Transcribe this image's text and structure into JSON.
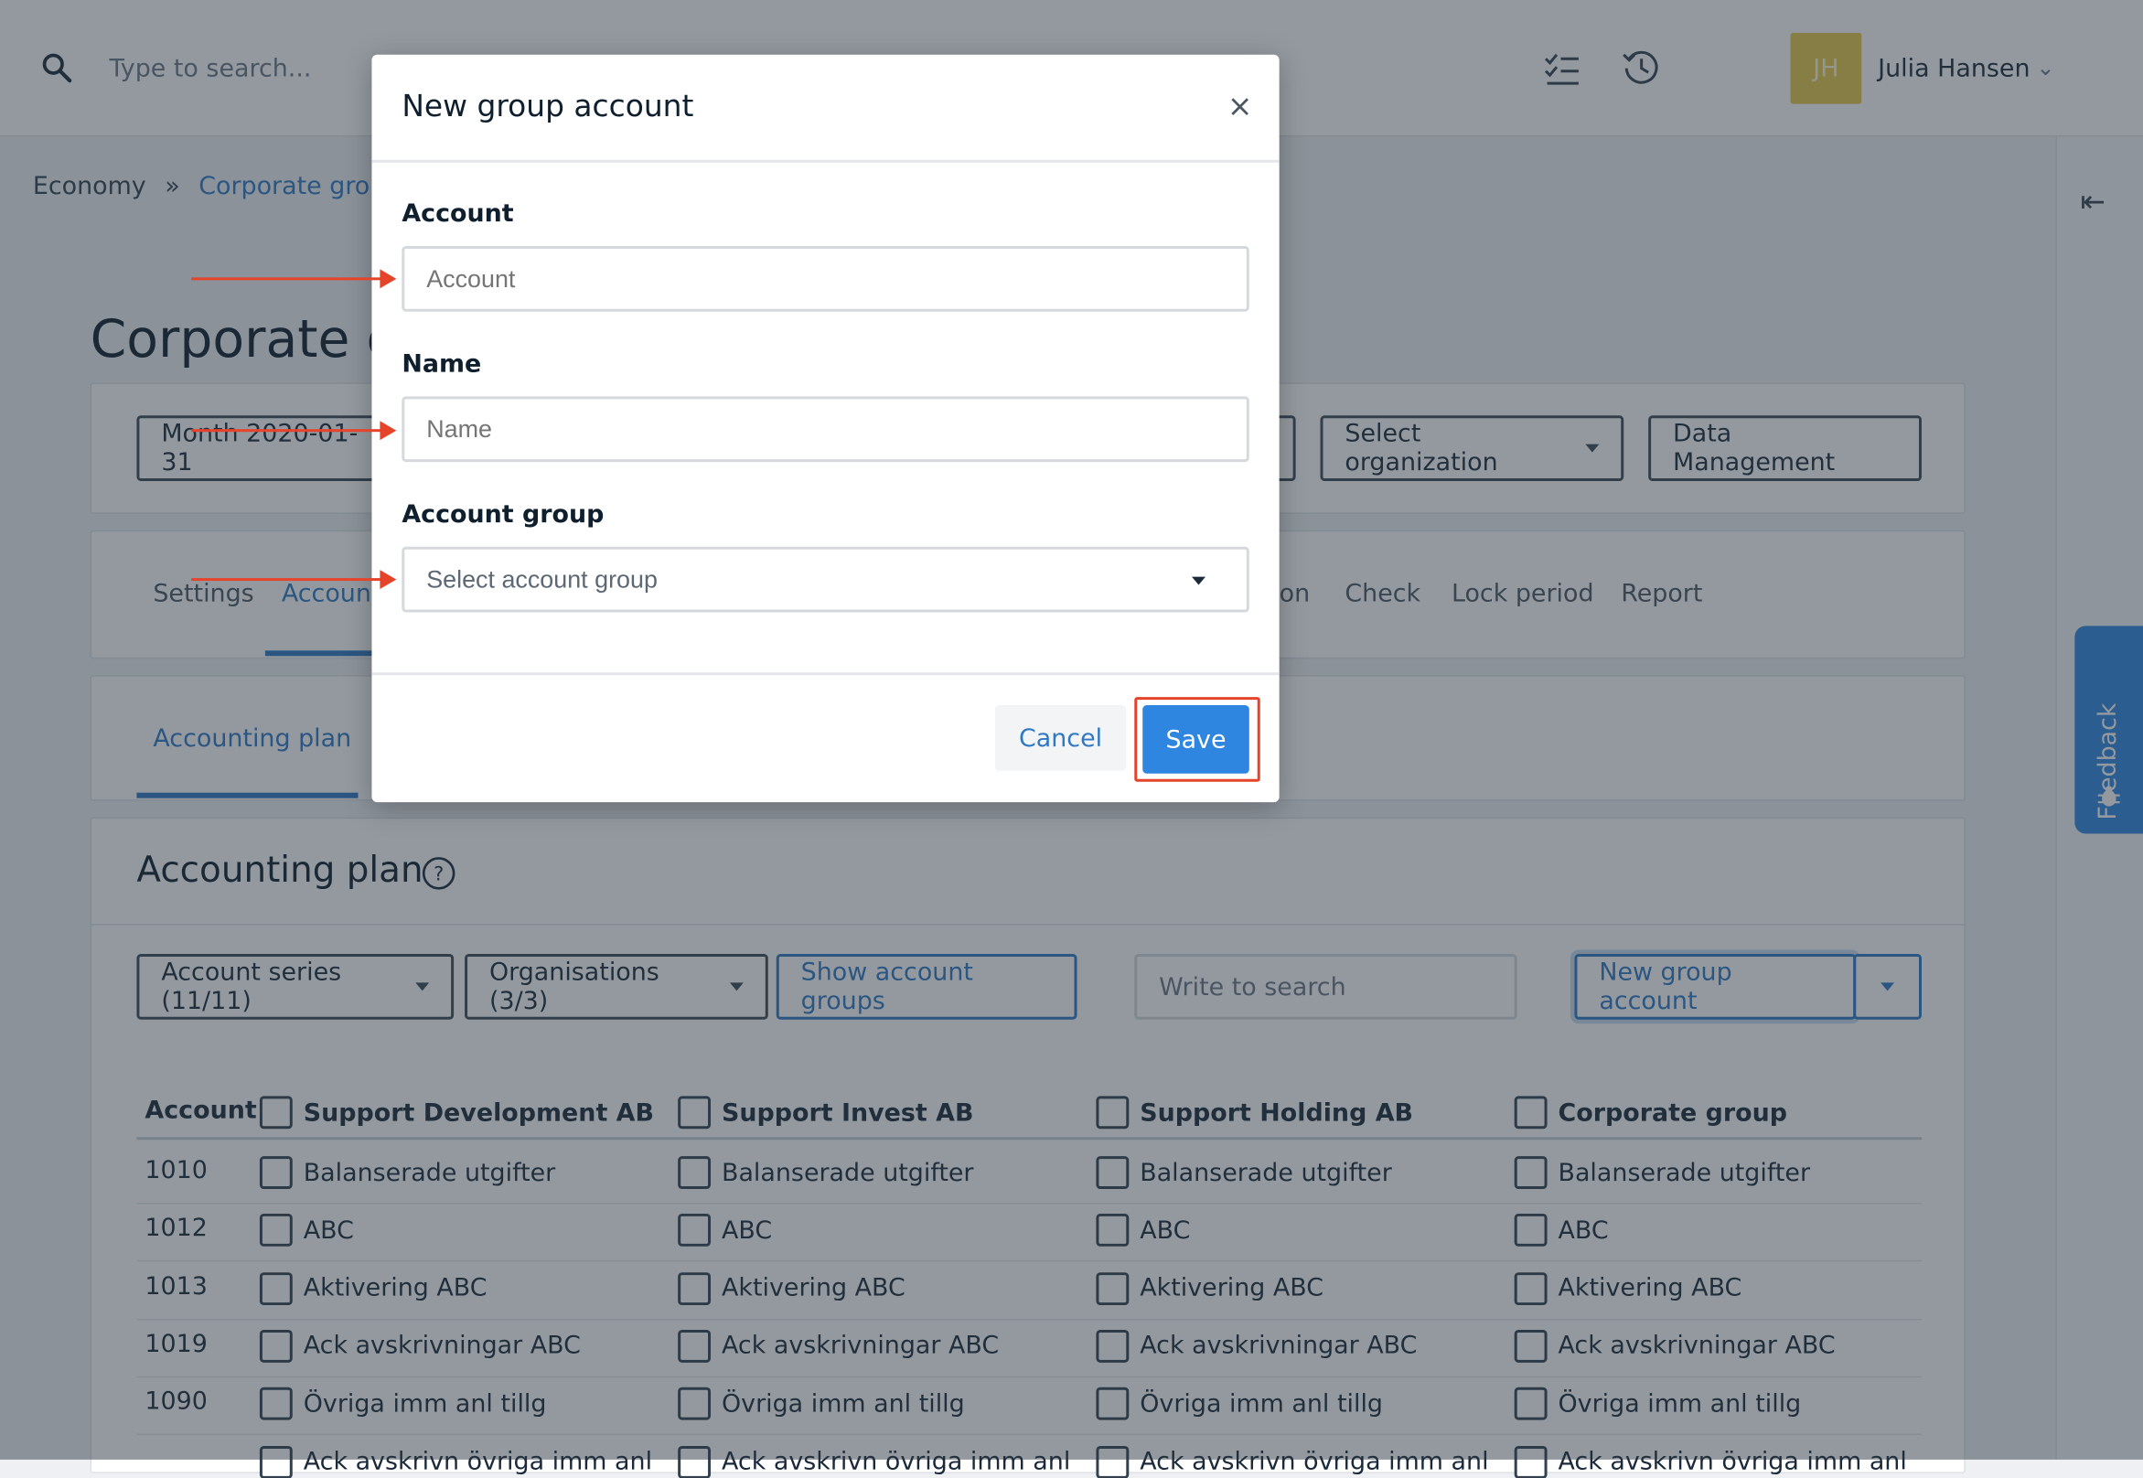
{
  "topbar": {
    "search_placeholder": "Type to search...",
    "avatar_initials": "JH",
    "user_name": "Julia Hansen"
  },
  "breadcrumb": {
    "root": "Economy",
    "separator": "»",
    "current": "Corporate group"
  },
  "page": {
    "title": "Corporate group"
  },
  "filters": {
    "period": "Month 2020-01-31",
    "select_organization": "Select organization",
    "data_management": "Data Management"
  },
  "main_tabs": [
    "Settings",
    "Accounts",
    "on",
    "Check",
    "Lock period",
    "Report"
  ],
  "sub_tabs": [
    "Accounting plan"
  ],
  "section": {
    "title": "Accounting plan"
  },
  "toolbar": {
    "account_series": "Account series (11/11)",
    "organisations": "Organisations (3/3)",
    "show_groups": "Show account groups",
    "search_placeholder": "Write to search",
    "new_group_account": "New group account"
  },
  "table": {
    "account_header": "Account",
    "columns": [
      "Support Development AB",
      "Support Invest AB",
      "Support Holding AB",
      "Corporate group"
    ],
    "rows": [
      {
        "account": "1010",
        "name": "Balanserade utgifter"
      },
      {
        "account": "1012",
        "name": "ABC"
      },
      {
        "account": "1013",
        "name": "Aktivering ABC"
      },
      {
        "account": "1019",
        "name": "Ack avskrivningar ABC"
      },
      {
        "account": "1090",
        "name": "Övriga imm anl tillg"
      },
      {
        "account": "",
        "name": "Ack avskrivn övriga imm anl"
      }
    ]
  },
  "feedback": {
    "label": "Feedback"
  },
  "modal": {
    "title": "New group account",
    "close": "×",
    "account_label": "Account",
    "account_placeholder": "Account",
    "name_label": "Name",
    "name_placeholder": "Name",
    "group_label": "Account group",
    "group_placeholder": "Select account group",
    "cancel": "Cancel",
    "save": "Save"
  },
  "colors": {
    "accent": "#2f86e0",
    "highlight": "#e5442b"
  }
}
